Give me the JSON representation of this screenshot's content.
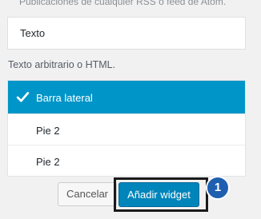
{
  "top_description": "Publicaciones de cualquier RSS o feed de Atom.",
  "widget": {
    "title": "Texto",
    "description": "Texto arbitrario o HTML."
  },
  "areas": [
    {
      "label": "Barra lateral",
      "selected": true
    },
    {
      "label": "Pie 2",
      "selected": false
    },
    {
      "label": "Pie 2",
      "selected": false
    }
  ],
  "buttons": {
    "cancel": "Cancelar",
    "add": "Añadir widget"
  },
  "step_badge": "1",
  "colors": {
    "selected_bg": "#0095c8",
    "primary_button": "#0085ba",
    "badge": "#1f5fb0"
  }
}
